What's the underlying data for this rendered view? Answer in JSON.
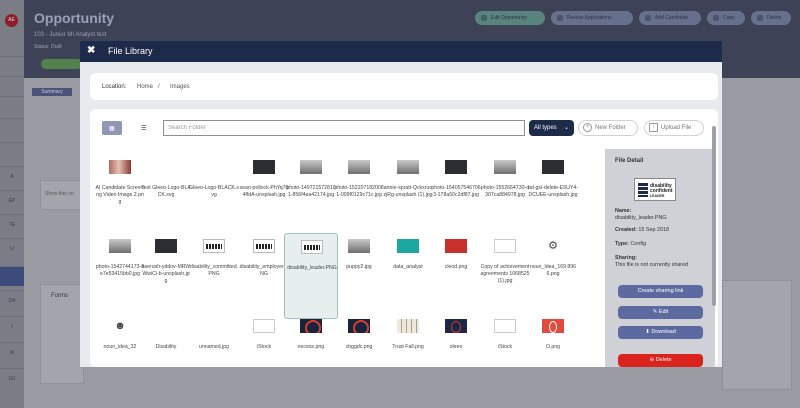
{
  "app": {
    "avatar": "AE",
    "title": "Opportunity",
    "subtitle": "103 - Junior MI Analyst test",
    "status": "Status: Draft",
    "header_buttons": [
      "Edit Opportunity",
      "Review Applications",
      "Add Candidate",
      "Copy",
      "Delete"
    ],
    "active_tab": "Summary",
    "left_items": [
      "",
      "",
      "",
      "",
      "",
      "A",
      "EP",
      "TE",
      "U",
      "",
      "OA",
      "I",
      "M",
      "SU"
    ],
    "background_labels": [
      "Show this on",
      "Forms"
    ]
  },
  "modal": {
    "title": "File Library",
    "close_icon": "✖",
    "location_label": "Location:",
    "location_home": "Home",
    "location_sep": "/",
    "location_images": "Images",
    "search_placeholder": "Search Folder",
    "type_select": "All types",
    "new_folder": "New Folder",
    "upload_file": "Upload File"
  },
  "files": [
    {
      "name": "AI Candidate Screening Video Image 2.png",
      "thumb": "photo1"
    },
    {
      "name": "Test Gleeo-Logo-BLACK.svg",
      "thumb": "blank"
    },
    {
      "name": "Gleeo-Logo-BLACK.svg",
      "thumb": "blank"
    },
    {
      "name": "sean-pollock-PhYq704ffdA-unsplash.jpg",
      "thumb": "dark"
    },
    {
      "name": "photo-1497215728101-856f4ea42174.jpg",
      "thumb": "photo2"
    },
    {
      "name": "photo-1522071820081-009f0129c71c.jpg",
      "thumb": "photo2"
    },
    {
      "name": "annie-spratt-QckxruozjRg-unsplash (1).jpg",
      "thumb": "photo2"
    },
    {
      "name": "photo-1540575467063-178a50c2df87.jpg",
      "thumb": "dark"
    },
    {
      "name": "photo-1552664730-d307ca884978.jpg",
      "thumb": "photo2"
    },
    {
      "name": "ad-gsl-delete-E5UY4-DCUEE-unsplash.jpg",
      "thumb": "dark"
    },
    {
      "name": "photo-1542744173-8e7e53415bb0.jpg",
      "thumb": "photo2"
    },
    {
      "name": "aserush-yddov-MRWWwiCi-b-unsplash.jpg",
      "thumb": "dark"
    },
    {
      "name": "disability_committed.PNG",
      "thumb": "logo"
    },
    {
      "name": "disability_employer.PNG",
      "thumb": "logo"
    },
    {
      "name": "disability_leader.PNG",
      "thumb": "logo",
      "selected": true
    },
    {
      "name": "puppy2.jpg",
      "thumb": "photo2"
    },
    {
      "name": "data_analyst",
      "thumb": "teal"
    },
    {
      "name": "cleod.png",
      "thumb": "red"
    },
    {
      "name": "Copy of achievement agreements 1068525 (1).jpg",
      "thumb": "white"
    },
    {
      "name": "noun_Idea_169 8966.png",
      "thumb": "icon"
    },
    {
      "name": "noun_idea_32",
      "thumb": "icon"
    },
    {
      "name": "Disability",
      "thumb": "blank"
    },
    {
      "name": "unnamed.jpg",
      "thumb": "blank"
    },
    {
      "name": "iStock",
      "thumb": "white"
    },
    {
      "name": "excess.png",
      "thumb": "circle"
    },
    {
      "name": "cbggdc.png",
      "thumb": "circle"
    },
    {
      "name": "Trust Fall.png",
      "thumb": "cups"
    },
    {
      "name": "oleeo",
      "thumb": "navy"
    },
    {
      "name": "iStock",
      "thumb": "white"
    },
    {
      "name": "O.png",
      "thumb": "redcard"
    }
  ],
  "detail": {
    "title": "File Detail",
    "logo_text_1": "disability",
    "logo_text_2": "confident",
    "logo_text_3": "LEADER",
    "name_label": "Name:",
    "name_value": "disability_leader.PNG",
    "created_label": "Created:",
    "created_value": "15 Sep 2018",
    "type_label": "Type:",
    "type_value": "Config",
    "sharing_label": "Sharing:",
    "sharing_value": "This file is not currently shared",
    "btn_share": "Create sharing link",
    "btn_edit": "Edit",
    "btn_download": "Download",
    "btn_delete": "Delete"
  }
}
